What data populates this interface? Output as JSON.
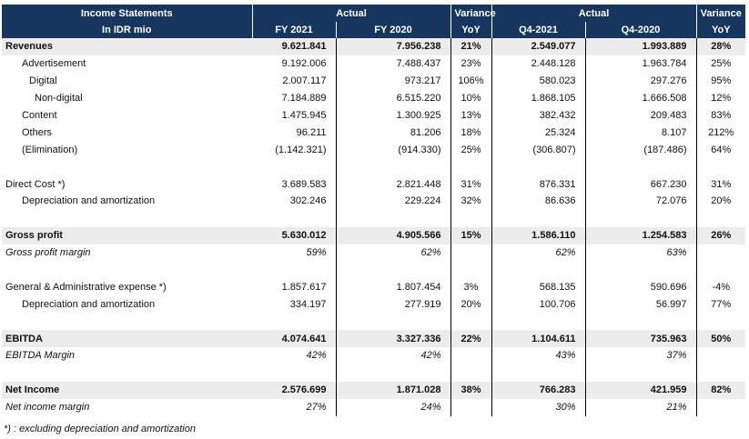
{
  "header": {
    "title": "Income Statements",
    "unit": "In IDR mio",
    "actual_label": "Actual",
    "variance_label": "Variance",
    "fy2021": "FY 2021",
    "fy2020": "FY 2020",
    "yoy": "YoY",
    "q42021": "Q4-2021",
    "q42020": "Q4-2020"
  },
  "rows": [
    {
      "label": "Revenues",
      "fy21": "9.621.841",
      "fy20": "7.956.238",
      "var1": "21%",
      "q421": "2.549.077",
      "q420": "1.993.889",
      "var2": "28%"
    },
    {
      "label": "Advertisement",
      "fy21": "9.192.006",
      "fy20": "7.488.437",
      "var1": "23%",
      "q421": "2.448.128",
      "q420": "1.963.784",
      "var2": "25%"
    },
    {
      "label": "Digital",
      "fy21": "2.007.117",
      "fy20": "973.217",
      "var1": "106%",
      "q421": "580.023",
      "q420": "297.276",
      "var2": "95%"
    },
    {
      "label": "Non-digital",
      "fy21": "7.184.889",
      "fy20": "6.515.220",
      "var1": "10%",
      "q421": "1.868.105",
      "q420": "1.666.508",
      "var2": "12%"
    },
    {
      "label": "Content",
      "fy21": "1.475.945",
      "fy20": "1.300.925",
      "var1": "13%",
      "q421": "382.432",
      "q420": "209.483",
      "var2": "83%"
    },
    {
      "label": "Others",
      "fy21": "96.211",
      "fy20": "81.206",
      "var1": "18%",
      "q421": "25.324",
      "q420": "8.107",
      "var2": "212%"
    },
    {
      "label": "(Elimination)",
      "fy21": "(1.142.321)",
      "fy20": "(914.330)",
      "var1": "25%",
      "q421": "(306.807)",
      "q420": "(187.486)",
      "var2": "64%"
    },
    {
      "label": "Direct Cost *)",
      "fy21": "3.689.583",
      "fy20": "2.821.448",
      "var1": "31%",
      "q421": "876.331",
      "q420": "667.230",
      "var2": "31%"
    },
    {
      "label": "Depreciation and amortization",
      "fy21": "302.246",
      "fy20": "229.224",
      "var1": "32%",
      "q421": "86.636",
      "q420": "72.076",
      "var2": "20%"
    },
    {
      "label": "Gross profit",
      "fy21": "5.630.012",
      "fy20": "4.905.566",
      "var1": "15%",
      "q421": "1.586.110",
      "q420": "1.254.583",
      "var2": "26%"
    },
    {
      "label": "Gross profit margin",
      "fy21": "59%",
      "fy20": "62%",
      "var1": "",
      "q421": "62%",
      "q420": "63%",
      "var2": ""
    },
    {
      "label": "General & Administrative expense *)",
      "fy21": "1.857.617",
      "fy20": "1.807.454",
      "var1": "3%",
      "q421": "568.135",
      "q420": "590.696",
      "var2": "-4%"
    },
    {
      "label": "Depreciation and amortization",
      "fy21": "334.197",
      "fy20": "277.919",
      "var1": "20%",
      "q421": "100.706",
      "q420": "56.997",
      "var2": "77%"
    },
    {
      "label": "EBITDA",
      "fy21": "4.074.641",
      "fy20": "3.327.336",
      "var1": "22%",
      "q421": "1.104.611",
      "q420": "735.963",
      "var2": "50%"
    },
    {
      "label": "EBITDA Margin",
      "fy21": "42%",
      "fy20": "42%",
      "var1": "",
      "q421": "43%",
      "q420": "37%",
      "var2": ""
    },
    {
      "label": "Net Income",
      "fy21": "2.576.699",
      "fy20": "1.871.028",
      "var1": "38%",
      "q421": "766.283",
      "q420": "421.959",
      "var2": "82%"
    },
    {
      "label": "Net income margin",
      "fy21": "27%",
      "fy20": "24%",
      "var1": "",
      "q421": "30%",
      "q420": "21%",
      "var2": ""
    }
  ],
  "footnote": "*) : excluding depreciation and amortization",
  "colors": {
    "header_bg": "#17365d",
    "shade": "#ececec"
  }
}
